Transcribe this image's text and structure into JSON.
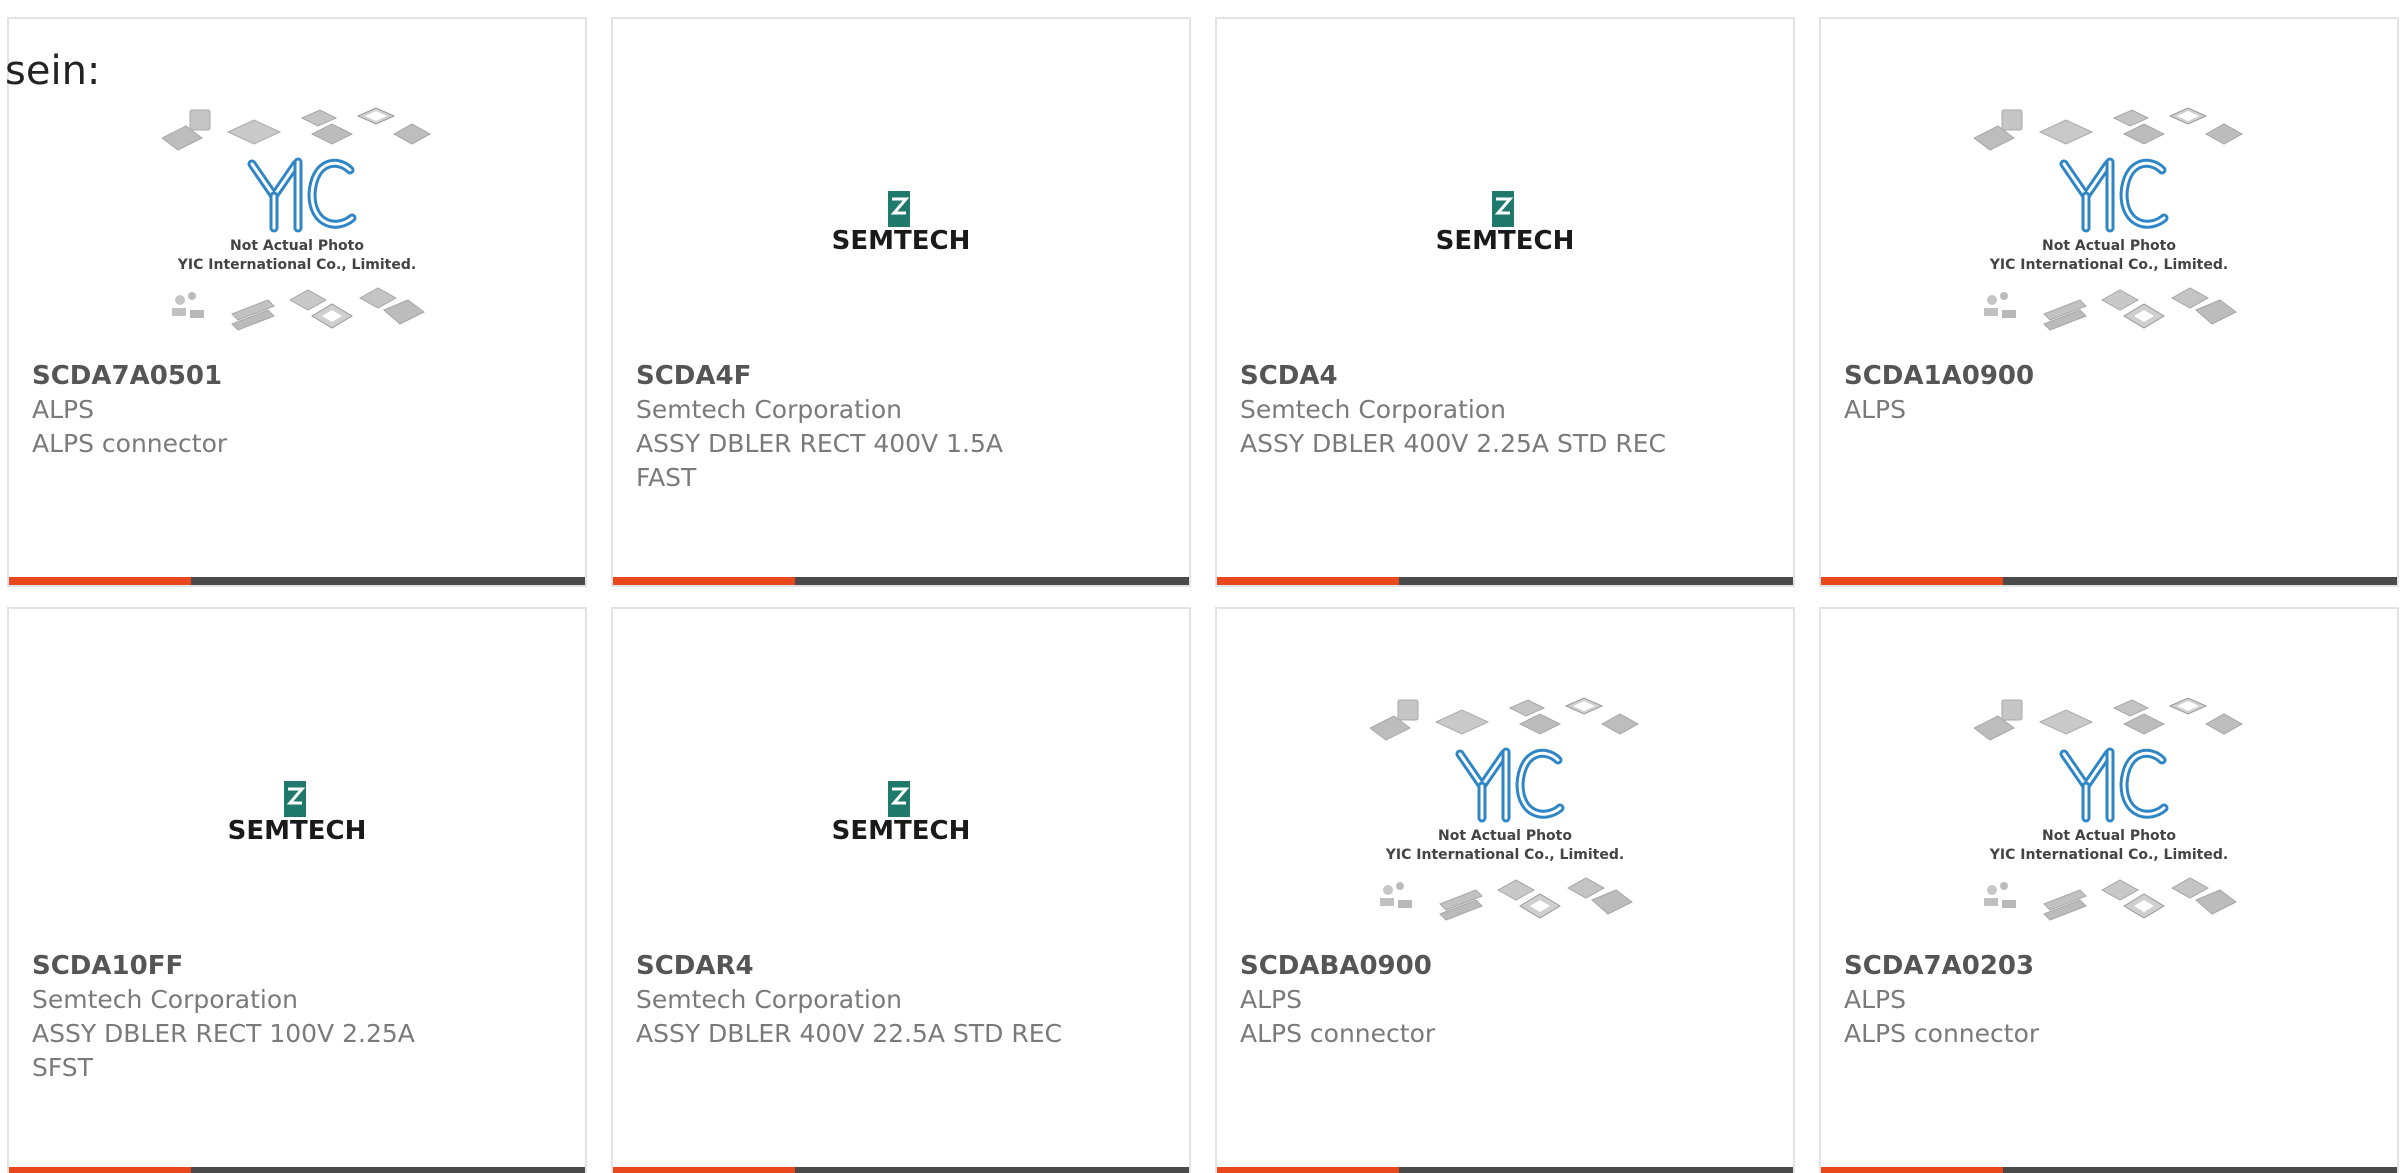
{
  "intro_text": "sein:",
  "colors": {
    "accent": "#e8481c",
    "bar": "#4a4a4a",
    "semtech_green": "#1f7a6c",
    "yic_blue": "#2f86c6",
    "chip_grey": "#c4c4c4"
  },
  "placeholder": {
    "line1": "Not Actual Photo",
    "line2": "YIC International Co., Limited."
  },
  "semtech_logo_text": "SEMTECH",
  "products": [
    {
      "part": "SCDA7A0501",
      "maker": "ALPS",
      "desc": "ALPS connector",
      "image": "yic-placeholder"
    },
    {
      "part": "SCDA4F",
      "maker": "Semtech Corporation",
      "desc": "ASSY DBLER RECT 400V 1.5A FAST",
      "image": "semtech-logo"
    },
    {
      "part": "SCDA4",
      "maker": "Semtech Corporation",
      "desc": "ASSY DBLER 400V 2.25A STD REC",
      "image": "semtech-logo"
    },
    {
      "part": "SCDA1A0900",
      "maker": "ALPS",
      "desc": "",
      "image": "yic-placeholder"
    },
    {
      "part": "SCDA10FF",
      "maker": "Semtech Corporation",
      "desc": "ASSY DBLER RECT 100V 2.25A SFST",
      "image": "semtech-logo"
    },
    {
      "part": "SCDAR4",
      "maker": "Semtech Corporation",
      "desc": "ASSY DBLER 400V 22.5A STD REC",
      "image": "semtech-logo"
    },
    {
      "part": "SCDABA0900",
      "maker": "ALPS",
      "desc": "ALPS connector",
      "image": "yic-placeholder"
    },
    {
      "part": "SCDA7A0203",
      "maker": "ALPS",
      "desc": "ALPS connector",
      "image": "yic-placeholder"
    }
  ]
}
